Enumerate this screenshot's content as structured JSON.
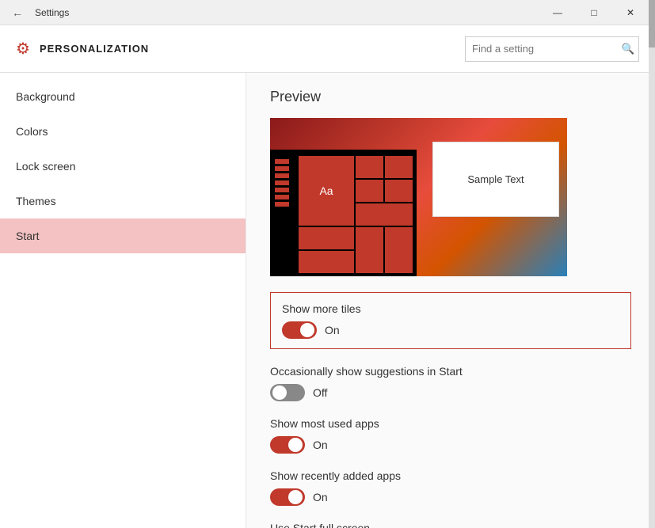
{
  "titleBar": {
    "title": "Settings",
    "minBtn": "—",
    "maxBtn": "□",
    "closeBtn": "✕"
  },
  "header": {
    "icon": "⚙",
    "title": "PERSONALIZATION",
    "search": {
      "placeholder": "Find a setting",
      "searchIcon": "🔍"
    }
  },
  "sidebar": {
    "items": [
      {
        "id": "background",
        "label": "Background"
      },
      {
        "id": "colors",
        "label": "Colors"
      },
      {
        "id": "lock-screen",
        "label": "Lock screen"
      },
      {
        "id": "themes",
        "label": "Themes"
      },
      {
        "id": "start",
        "label": "Start"
      }
    ]
  },
  "content": {
    "previewTitle": "Preview",
    "previewSampleText": "Sample Text",
    "settings": [
      {
        "id": "show-more-tiles",
        "label": "Show more tiles",
        "state": "on",
        "stateLabel": "On",
        "highlighted": true
      },
      {
        "id": "suggestions",
        "label": "Occasionally show suggestions in Start",
        "state": "off",
        "stateLabel": "Off",
        "highlighted": false
      },
      {
        "id": "most-used",
        "label": "Show most used apps",
        "state": "on",
        "stateLabel": "On",
        "highlighted": false
      },
      {
        "id": "recently-added",
        "label": "Show recently added apps",
        "state": "on",
        "stateLabel": "On",
        "highlighted": false
      },
      {
        "id": "full-screen",
        "label": "Use Start full screen",
        "state": "off",
        "stateLabel": "",
        "highlighted": false
      }
    ]
  }
}
